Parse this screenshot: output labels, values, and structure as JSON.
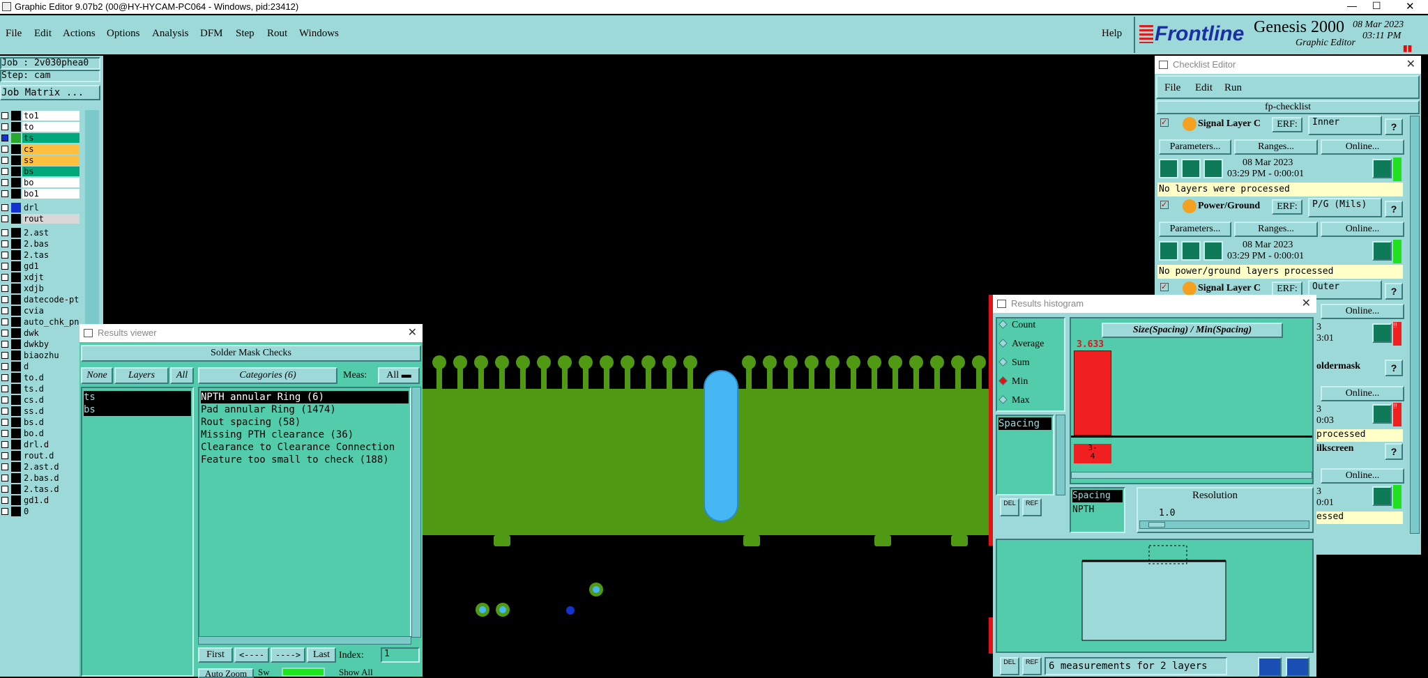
{
  "app_title": "Graphic Editor 9.07b2 (00@HY-HYCAM-PC064 - Windows, pid:23412)",
  "menu": [
    "File",
    "Edit",
    "Actions",
    "Options",
    "Analysis",
    "DFM",
    "Step",
    "Rout",
    "Windows"
  ],
  "help": "Help",
  "brand": {
    "logo": "Frontline",
    "product": "Genesis 2000",
    "sub": "Graphic Editor",
    "date": "08 Mar 2023",
    "time": "03:11 PM"
  },
  "job": {
    "job_label": "Job : 2v030phea0",
    "step_label": "Step: cam",
    "matrix_btn": "Job Matrix ..."
  },
  "layers": [
    {
      "name": "to1",
      "color": "#ffffff",
      "sw": "#000000"
    },
    {
      "name": "to",
      "color": "#ffffff",
      "sw": "#000000"
    },
    {
      "name": "ts",
      "color": "#00a87a",
      "sw": "#2aa830",
      "sel": true
    },
    {
      "name": "cs",
      "color": "#ffc040",
      "sw": "#000000"
    },
    {
      "name": "ss",
      "color": "#ffc040",
      "sw": "#000000"
    },
    {
      "name": "bs",
      "color": "#00a87a",
      "sw": "#000000"
    },
    {
      "name": "bo",
      "color": "#ffffff",
      "sw": "#000000"
    },
    {
      "name": "bo1",
      "color": "#ffffff",
      "sw": "#000000"
    },
    {
      "name": "drl",
      "color": "#9ed9d9",
      "sw": "#1432d0"
    },
    {
      "name": "rout",
      "color": "#d8d8d8",
      "sw": "#000000"
    },
    {
      "name": "2.ast",
      "color": "#9ed9d9",
      "sw": "#000000"
    },
    {
      "name": "2.bas",
      "color": "#9ed9d9",
      "sw": "#000000"
    },
    {
      "name": "2.tas",
      "color": "#9ed9d9",
      "sw": "#000000"
    },
    {
      "name": "gd1",
      "color": "#9ed9d9",
      "sw": "#000000"
    },
    {
      "name": "xdjt",
      "color": "#9ed9d9",
      "sw": "#000000"
    },
    {
      "name": "xdjb",
      "color": "#9ed9d9",
      "sw": "#000000"
    },
    {
      "name": "datecode-pt",
      "color": "#9ed9d9",
      "sw": "#000000"
    },
    {
      "name": "cvia",
      "color": "#9ed9d9",
      "sw": "#000000"
    },
    {
      "name": "auto_chk_pn",
      "color": "#9ed9d9",
      "sw": "#000000"
    },
    {
      "name": "dwk",
      "color": "#9ed9d9",
      "sw": "#000000"
    },
    {
      "name": "dwkby",
      "color": "#9ed9d9",
      "sw": "#000000"
    },
    {
      "name": "biaozhu",
      "color": "#9ed9d9",
      "sw": "#000000"
    },
    {
      "name": "d",
      "color": "#9ed9d9",
      "sw": "#000000"
    },
    {
      "name": "to.d",
      "color": "#9ed9d9",
      "sw": "#000000"
    },
    {
      "name": "ts.d",
      "color": "#9ed9d9",
      "sw": "#000000"
    },
    {
      "name": "cs.d",
      "color": "#9ed9d9",
      "sw": "#000000"
    },
    {
      "name": "ss.d",
      "color": "#9ed9d9",
      "sw": "#000000"
    },
    {
      "name": "bs.d",
      "color": "#9ed9d9",
      "sw": "#000000"
    },
    {
      "name": "bo.d",
      "color": "#9ed9d9",
      "sw": "#000000"
    },
    {
      "name": "drl.d",
      "color": "#9ed9d9",
      "sw": "#000000"
    },
    {
      "name": "rout.d",
      "color": "#9ed9d9",
      "sw": "#000000"
    },
    {
      "name": "2.ast.d",
      "color": "#9ed9d9",
      "sw": "#000000"
    },
    {
      "name": "2.bas.d",
      "color": "#9ed9d9",
      "sw": "#000000"
    },
    {
      "name": "2.tas.d",
      "color": "#9ed9d9",
      "sw": "#000000"
    },
    {
      "name": "gd1.d",
      "color": "#9ed9d9",
      "sw": "#000000"
    },
    {
      "name": "0",
      "color": "#9ed9d9",
      "sw": "#000000"
    }
  ],
  "results_viewer": {
    "title": "Results viewer",
    "header": "Solder Mask Checks",
    "none": "None",
    "layers_lbl": "Layers",
    "all": "All",
    "layer_items": [
      "ts",
      "bs"
    ],
    "categories_lbl": "Categories (6)",
    "meas_lbl": "Meas:",
    "meas_val": "All",
    "categories": [
      "NPTH annular Ring (6)",
      "Pad annular Ring (1474)",
      "Rout spacing (58)",
      "Missing PTH clearance (36)",
      "Clearance to Clearance Connection",
      "Feature too small to check (188)"
    ],
    "first": "First",
    "prev": "<----",
    "next": "---->",
    "last": "Last",
    "index_lbl": "Index:",
    "index_val": "1",
    "auto_zoom": "Auto Zoom",
    "show_all": "Show All",
    "sw": "Sw"
  },
  "checklist": {
    "title": "Checklist Editor",
    "menu": [
      "File",
      "Edit",
      "Run"
    ],
    "name": "fp-checklist",
    "checks": [
      {
        "name": "Signal Layer Ch",
        "erf": "ERF:",
        "erf_val": "Inner",
        "date": "08 Mar 2023",
        "time": "03:29 PM - 0:00:01",
        "msg": "No layers were processed"
      },
      {
        "name": "Power/Ground C",
        "erf": "ERF:",
        "erf_val": "P/G (Mils)",
        "date": "08 Mar 2023",
        "time": "03:29 PM - 0:00:01",
        "msg": "No power/ground layers processed"
      },
      {
        "name": "Signal Layer Ch",
        "erf": "ERF:",
        "erf_val": "Outer"
      }
    ],
    "params": "Parameters...",
    "ranges": "Ranges...",
    "online": "Online...",
    "frag": [
      "3",
      "3:01",
      "oldermask",
      "3",
      "0:03",
      "processed",
      "ilkscreen",
      "3",
      "0:01",
      "essed"
    ],
    "help": "?",
    "bang": "!!"
  },
  "histogram": {
    "title": "Results histogram",
    "options": [
      "Count",
      "Average",
      "Sum",
      "Min",
      "Max"
    ],
    "selected": "Min",
    "list_sel": "Spacing",
    "chart_title": "Size(Spacing) / Min(Spacing)",
    "bar_value": "3.633",
    "bin_label": "3-\n4",
    "tbl_col": [
      "Spacing",
      "NPTH"
    ],
    "resolution_lbl": "Resolution",
    "resolution_val": "1.0",
    "del": "DEL",
    "ref": "REF",
    "status": "6 measurements for 2 layers"
  },
  "colors": {
    "panel": "#9ed9d9",
    "win": "#52ccaa",
    "copper": "#4f9a12",
    "drill": "#45b7f2",
    "alert": "#ff0000"
  }
}
